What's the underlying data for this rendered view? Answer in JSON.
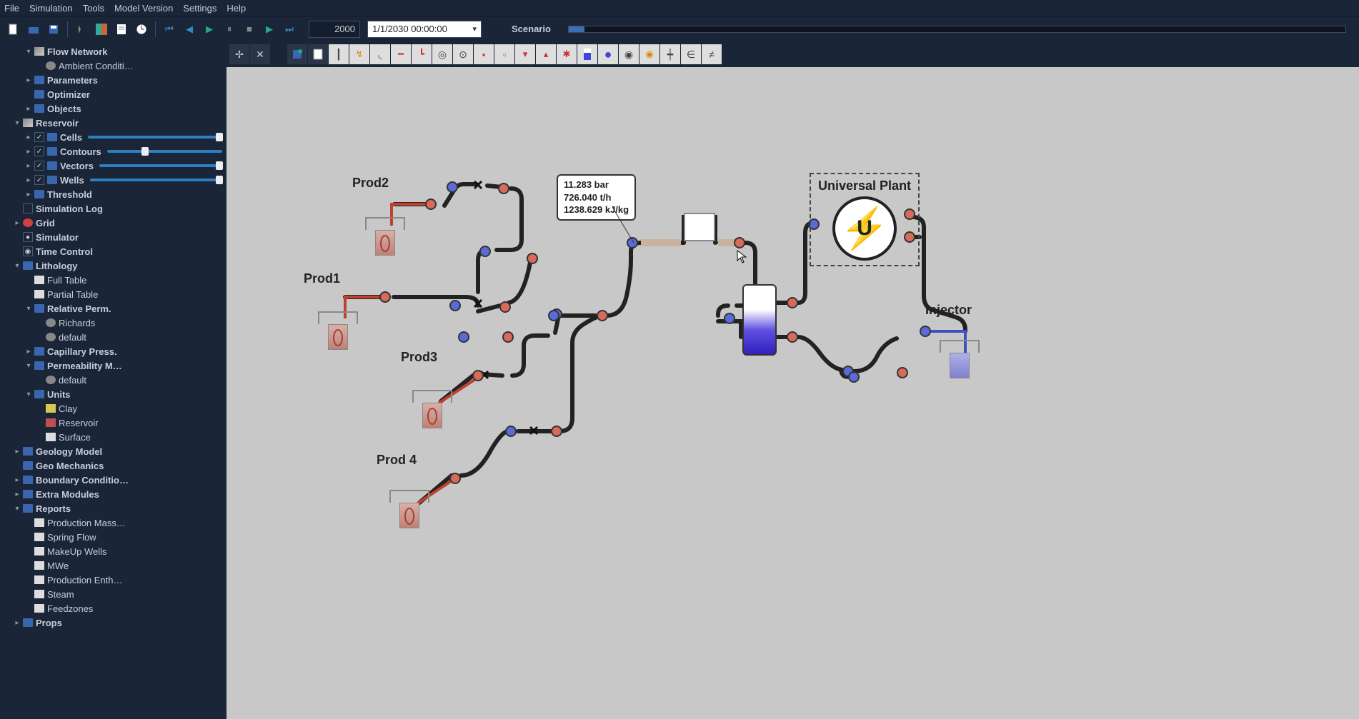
{
  "menu": {
    "items": [
      "File",
      "Simulation",
      "Tools",
      "Model Version",
      "Settings",
      "Help"
    ]
  },
  "toolbar1": {
    "year": "2000",
    "date": "1/1/2030 00:00:00",
    "scenario_label": "Scenario"
  },
  "sidebar": {
    "items": [
      {
        "indent": 0,
        "exp": "▾",
        "chk": "",
        "ico": "cube",
        "label": "Flow Network",
        "bold": true
      },
      {
        "indent": 1,
        "exp": "",
        "chk": "",
        "ico": "dot-gray",
        "label": "Ambient Conditi…"
      },
      {
        "indent": 0,
        "exp": "▸",
        "chk": "",
        "ico": "folder",
        "label": "Parameters",
        "bold": true
      },
      {
        "indent": 0,
        "exp": "",
        "chk": "",
        "ico": "folder",
        "label": "Optimizer",
        "bold": true
      },
      {
        "indent": 0,
        "exp": "▸",
        "chk": "",
        "ico": "folder",
        "label": "Objects",
        "bold": true
      },
      {
        "indent": -1,
        "exp": "▾",
        "chk": "",
        "ico": "cube",
        "label": "Reservoir",
        "bold": true
      },
      {
        "indent": 0,
        "exp": "▸",
        "chk": "✓",
        "ico": "folder",
        "label": "Cells",
        "bold": true,
        "slider": 100
      },
      {
        "indent": 0,
        "exp": "▸",
        "chk": "✓",
        "ico": "folder",
        "label": "Contours",
        "bold": true,
        "slider": 35
      },
      {
        "indent": 0,
        "exp": "▸",
        "chk": "✓",
        "ico": "folder",
        "label": "Vectors",
        "bold": true,
        "slider": 100
      },
      {
        "indent": 0,
        "exp": "▸",
        "chk": "✓",
        "ico": "folder",
        "label": "Wells",
        "bold": true,
        "slider": 100
      },
      {
        "indent": 0,
        "exp": "▸",
        "chk": "",
        "ico": "folder",
        "label": "Threshold",
        "bold": true
      },
      {
        "indent": -1,
        "exp": "",
        "chk": "□",
        "ico": "",
        "label": "Simulation Log",
        "bold": true
      },
      {
        "indent": -1,
        "exp": "▸",
        "chk": "",
        "ico": "dot-red",
        "label": "Grid",
        "bold": true
      },
      {
        "indent": -1,
        "exp": "",
        "chk": "●",
        "ico": "",
        "label": "Simulator",
        "bold": true
      },
      {
        "indent": -1,
        "exp": "",
        "chk": "◉",
        "ico": "",
        "label": "Time Control",
        "bold": true
      },
      {
        "indent": -1,
        "exp": "▾",
        "chk": "",
        "ico": "folder",
        "label": "Lithology",
        "bold": true
      },
      {
        "indent": 0,
        "exp": "",
        "chk": "",
        "ico": "sq-wht",
        "label": "Full Table"
      },
      {
        "indent": 0,
        "exp": "",
        "chk": "",
        "ico": "sq-wht",
        "label": "Partial Table"
      },
      {
        "indent": 0,
        "exp": "▾",
        "chk": "",
        "ico": "folder",
        "label": "Relative Perm.",
        "bold": true
      },
      {
        "indent": 1,
        "exp": "",
        "chk": "",
        "ico": "dot-gray",
        "label": "Richards"
      },
      {
        "indent": 1,
        "exp": "",
        "chk": "",
        "ico": "dot-gray",
        "label": "default"
      },
      {
        "indent": 0,
        "exp": "▸",
        "chk": "",
        "ico": "folder",
        "label": "Capillary Press.",
        "bold": true
      },
      {
        "indent": 0,
        "exp": "▾",
        "chk": "",
        "ico": "folder",
        "label": "Permeability M…",
        "bold": true
      },
      {
        "indent": 1,
        "exp": "",
        "chk": "",
        "ico": "dot-gray",
        "label": "default"
      },
      {
        "indent": 0,
        "exp": "▾",
        "chk": "",
        "ico": "folder",
        "label": "Units",
        "bold": true
      },
      {
        "indent": 1,
        "exp": "",
        "chk": "",
        "ico": "sq-ylw",
        "label": "Clay"
      },
      {
        "indent": 1,
        "exp": "",
        "chk": "",
        "ico": "sq-red",
        "label": "Reservoir"
      },
      {
        "indent": 1,
        "exp": "",
        "chk": "",
        "ico": "sq-wht",
        "label": "Surface"
      },
      {
        "indent": -1,
        "exp": "▸",
        "chk": "",
        "ico": "folder",
        "label": "Geology Model",
        "bold": true
      },
      {
        "indent": -1,
        "exp": "",
        "chk": "",
        "ico": "folder",
        "label": "Geo Mechanics",
        "bold": true
      },
      {
        "indent": -1,
        "exp": "▸",
        "chk": "",
        "ico": "folder",
        "label": "Boundary Conditio…",
        "bold": true
      },
      {
        "indent": -1,
        "exp": "▸",
        "chk": "",
        "ico": "folder",
        "label": "Extra Modules",
        "bold": true
      },
      {
        "indent": -1,
        "exp": "▾",
        "chk": "",
        "ico": "folder",
        "label": "Reports",
        "bold": true
      },
      {
        "indent": 0,
        "exp": "",
        "chk": "",
        "ico": "sq-wht",
        "label": "Production Mass…"
      },
      {
        "indent": 0,
        "exp": "",
        "chk": "",
        "ico": "sq-wht",
        "label": "Spring Flow"
      },
      {
        "indent": 0,
        "exp": "",
        "chk": "",
        "ico": "sq-wht",
        "label": "MakeUp Wells"
      },
      {
        "indent": 0,
        "exp": "",
        "chk": "",
        "ico": "sq-wht",
        "label": "MWe"
      },
      {
        "indent": 0,
        "exp": "",
        "chk": "",
        "ico": "sq-wht",
        "label": "Production Enth…"
      },
      {
        "indent": 0,
        "exp": "",
        "chk": "",
        "ico": "sq-wht",
        "label": "Steam"
      },
      {
        "indent": 0,
        "exp": "",
        "chk": "",
        "ico": "sq-wht",
        "label": "Feedzones"
      },
      {
        "indent": -1,
        "exp": "▸",
        "chk": "",
        "ico": "folder",
        "label": "Props",
        "bold": true
      }
    ]
  },
  "canvas": {
    "labels": {
      "prod1": "Prod1",
      "prod2": "Prod2",
      "prod3": "Prod3",
      "prod4": "Prod 4",
      "injector": "Injector",
      "plant": "Universal Plant"
    },
    "tooltip": {
      "line1": "11.283 bar",
      "line2": "726.040 t/h",
      "line3": "1238.629 kJ/kg"
    },
    "plant_letter": "U"
  }
}
